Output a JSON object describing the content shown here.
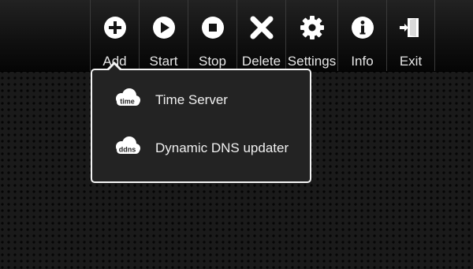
{
  "toolbar": {
    "buttons": [
      {
        "label": "Add",
        "icon": "plus-circle-icon"
      },
      {
        "label": "Start",
        "icon": "play-circle-icon"
      },
      {
        "label": "Stop",
        "icon": "stop-circle-icon"
      },
      {
        "label": "Delete",
        "icon": "x-icon"
      },
      {
        "label": "Settings",
        "icon": "gear-icon"
      },
      {
        "label": "Info",
        "icon": "info-circle-icon"
      },
      {
        "label": "Exit",
        "icon": "door-exit-icon"
      }
    ]
  },
  "add_menu": {
    "items": [
      {
        "label": "Time Server",
        "icon_text": "time",
        "icon": "time-cloud-icon"
      },
      {
        "label": "Dynamic DNS updater",
        "icon_text": "ddns",
        "icon": "ddns-cloud-icon"
      }
    ]
  }
}
